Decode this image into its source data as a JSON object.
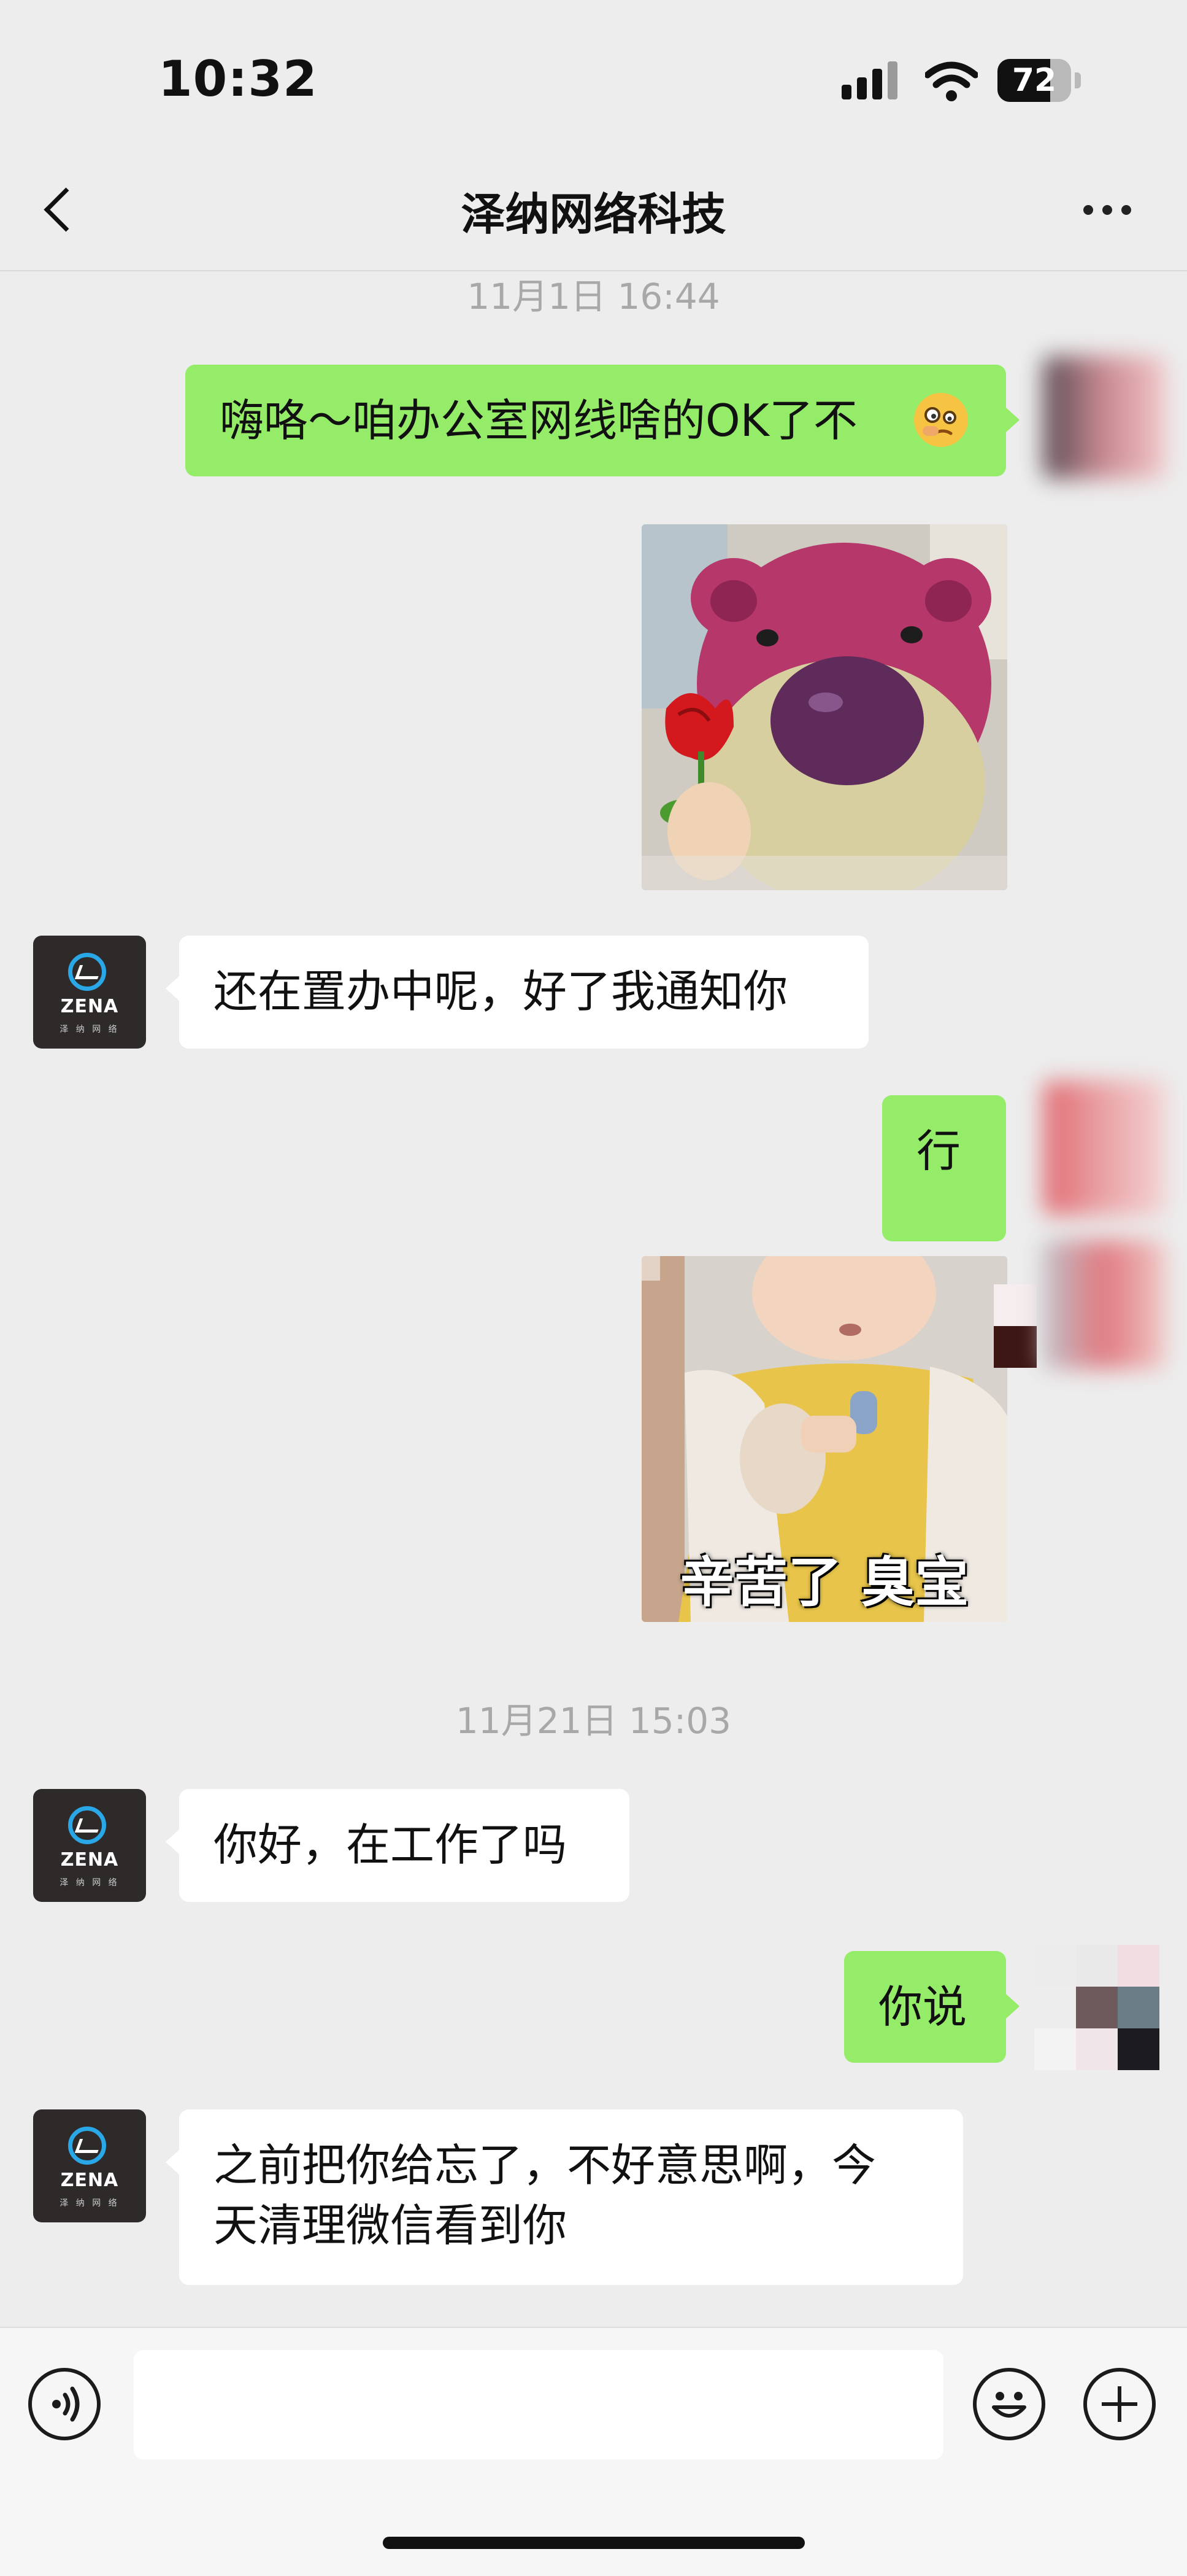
{
  "status_bar": {
    "time": "10:32",
    "battery_level": "72"
  },
  "header": {
    "title": "泽纳网络科技"
  },
  "contact_avatar": {
    "brand": "ZENA",
    "brand_sub": "泽 纳 网 络"
  },
  "messages": [
    {
      "type": "timestamp",
      "text": "11月1日 16:44"
    },
    {
      "type": "text",
      "sender": "me",
      "text": "嗨咯～咱办公室网线啥的OK了不"
    },
    {
      "type": "sticker",
      "sender": "me",
      "depicts": "pink plush bear holding a red rose"
    },
    {
      "type": "text",
      "sender": "contact",
      "text": "还在置办中呢，好了我通知你"
    },
    {
      "type": "text",
      "sender": "me",
      "text": "行"
    },
    {
      "type": "sticker",
      "sender": "me",
      "depicts": "toddler in yellow sweater",
      "caption": "辛苦了 臭宝"
    },
    {
      "type": "timestamp",
      "text": "11月21日 15:03"
    },
    {
      "type": "text",
      "sender": "contact",
      "text": "你好，在工作了吗"
    },
    {
      "type": "text",
      "sender": "me",
      "text": "你说"
    },
    {
      "type": "text",
      "sender": "contact",
      "text_line1": "之前把你给忘了，不好意思啊，今",
      "text_line2": "天清理微信看到你"
    }
  ],
  "input_bar": {
    "placeholder": ""
  },
  "colors": {
    "outgoing_bubble": "#95ec69",
    "incoming_bubble": "#ffffff",
    "background": "#ededed"
  }
}
